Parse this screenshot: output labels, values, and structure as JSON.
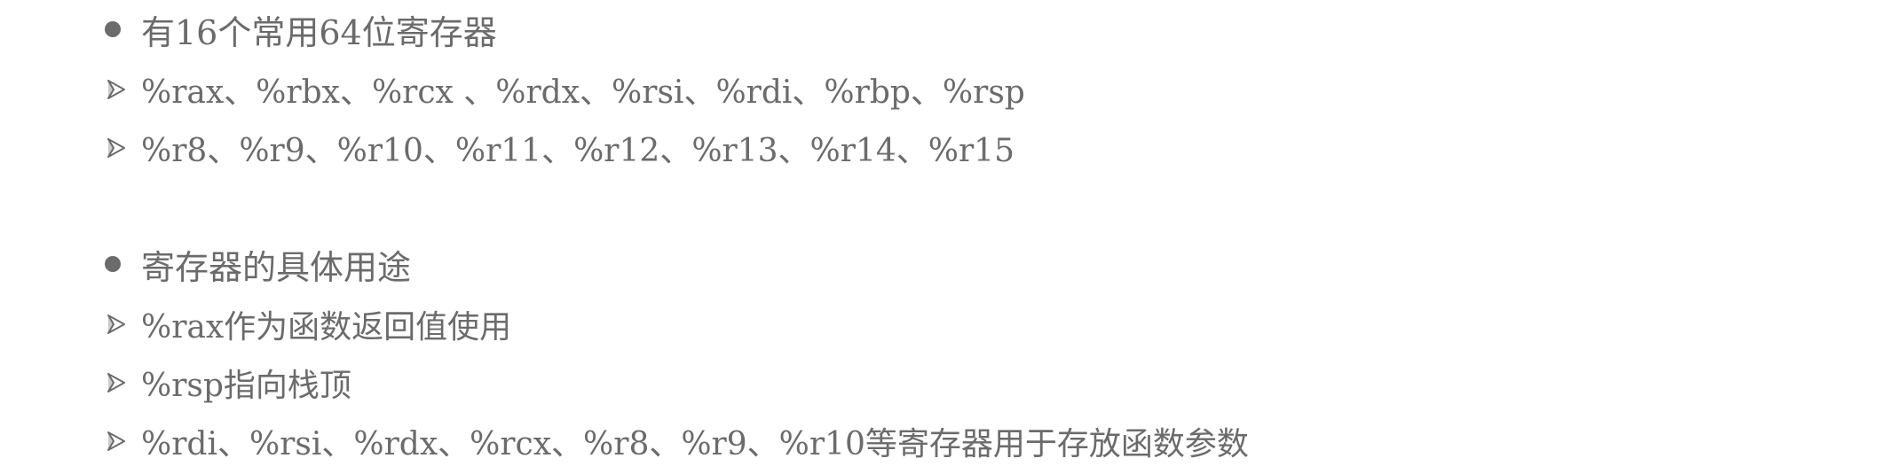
{
  "sections": [
    {
      "heading": "有16个常用64位寄存器",
      "items": [
        "%rax、%rbx、%rcx 、%rdx、%rsi、%rdi、%rbp、%rsp",
        "%r8、%r9、%r10、%r11、%r12、%r13、%r14、%r15"
      ]
    },
    {
      "heading": "寄存器的具体用途",
      "items": [
        "%rax作为函数返回值使用",
        "%rsp指向栈顶",
        "%rdi、%rsi、%rdx、%rcx、%r8、%r9、%r10等寄存器用于存放函数参数"
      ]
    }
  ],
  "colors": {
    "text": "#6b6b6b",
    "background": "#ffffff"
  },
  "icons": {
    "bullet": "filled-circle-bullet-icon",
    "sub_bullet": "arrowhead-bullet-icon"
  }
}
